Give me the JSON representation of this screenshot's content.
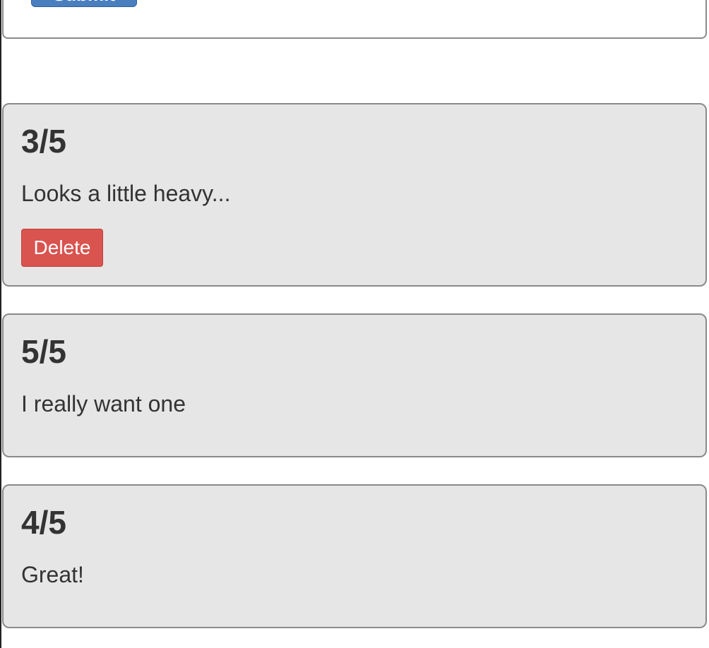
{
  "form": {
    "submit_label": "Submit"
  },
  "reviews": [
    {
      "rating": "3/5",
      "text": "Looks a little heavy...",
      "delete_label": "Delete"
    },
    {
      "rating": "5/5",
      "text": "I really want one"
    },
    {
      "rating": "4/5",
      "text": "Great!"
    }
  ],
  "colors": {
    "primary": "#4a7fbf",
    "danger": "#d9534f",
    "card_background": "#e6e6e6",
    "card_border": "#8a8a8a",
    "text": "#333333"
  }
}
